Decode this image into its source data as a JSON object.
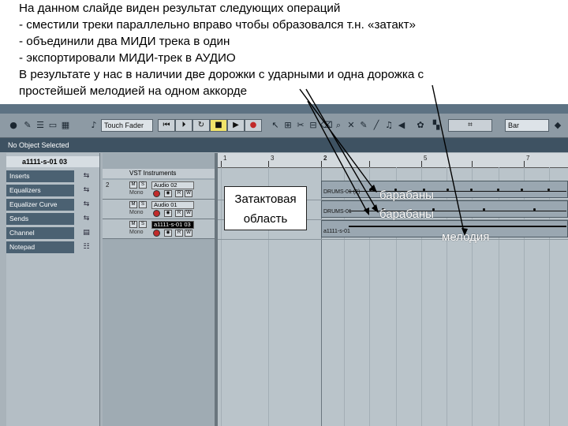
{
  "caption": {
    "lines": [
      "На данном слайде виден результат следующих операций",
      "- сместили треки параллельно вправо чтобы образовался т.н. «затакт»",
      "- объединили два МИДИ трека в один",
      "- экспортировали МИДИ-трек в АУДИО",
      "В результате у нас в наличии две дорожки с ударными и одна дорожка с",
      "простейшей мелодией на одном аккорде"
    ]
  },
  "toolbar": {
    "fader_select": "Touch Fader",
    "grid_select": "Bar"
  },
  "info_line": "No Object Selected",
  "inspector": {
    "title": "a1111-s-01 03",
    "items": [
      "Inserts",
      "Equalizers",
      "Equalizer Curve",
      "Sends",
      "Channel",
      "Notepad"
    ]
  },
  "tracklist": {
    "folder_name": "VST Instruments",
    "tracks": [
      {
        "number": "2",
        "name": "Audio 02",
        "mode": "Mono",
        "selected": false
      },
      {
        "number": "",
        "name": "Audio 01",
        "mode": "Mono",
        "selected": false
      },
      {
        "number": "",
        "name": "a1111-s-01 03",
        "mode": "Mono",
        "selected": true
      }
    ]
  },
  "ruler": {
    "marks": [
      "1",
      "3",
      "2",
      "5",
      "7"
    ]
  },
  "parts": [
    {
      "label": "DRUMS-01 (2)"
    },
    {
      "label": "DRUMS-01"
    },
    {
      "label": "a1111-s-01"
    }
  ],
  "annotations": {
    "zatakt_line1": "Затактовая",
    "zatakt_line2": "область",
    "drums1": "барабаны",
    "drums2": "барабаны",
    "melody": "мелодия"
  },
  "colors": {
    "accent_record": "#c12a2a",
    "info_bar": "#3e5262",
    "inspector_label": "#4b6172"
  }
}
